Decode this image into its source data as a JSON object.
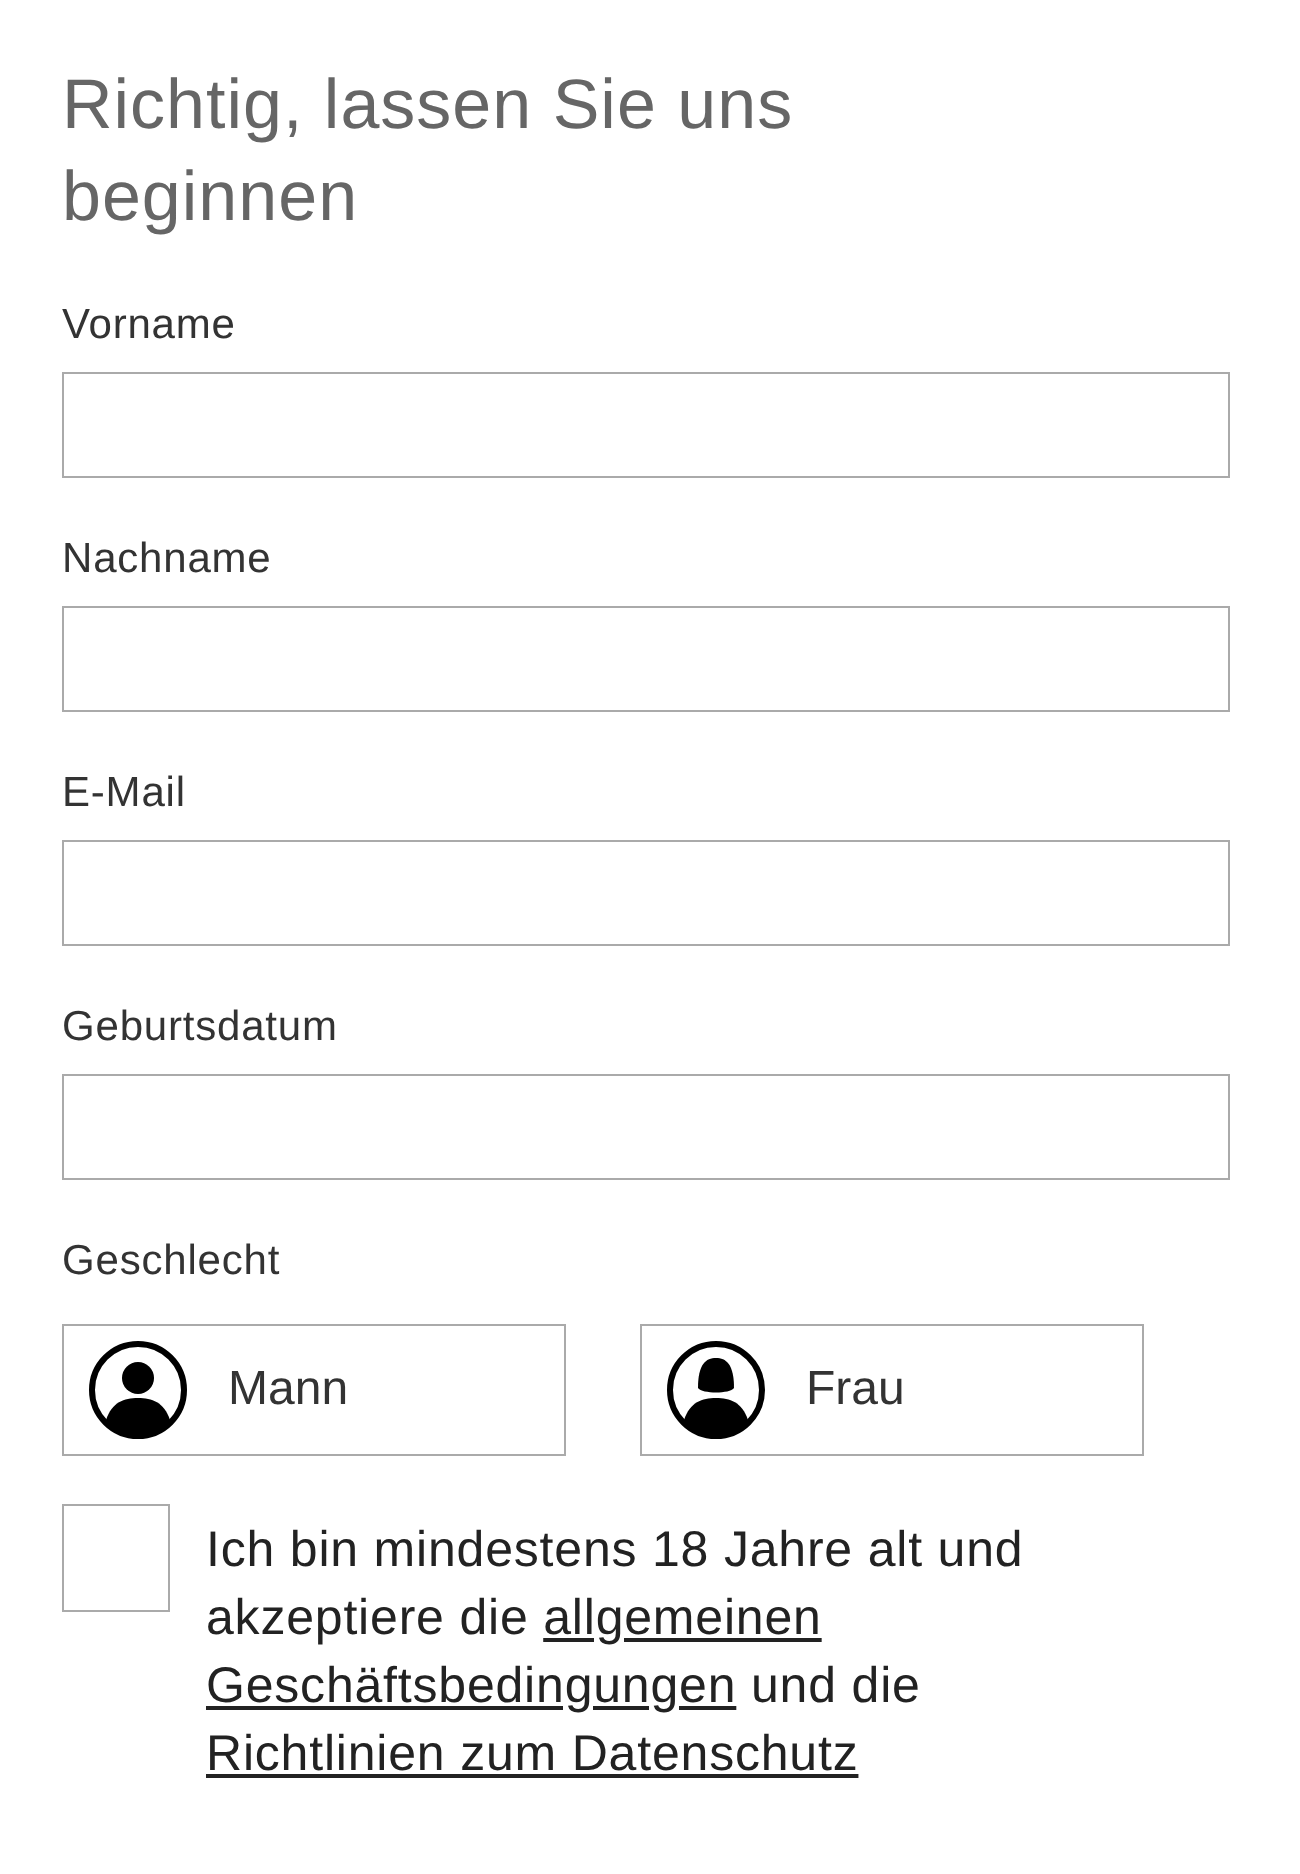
{
  "title": "Richtig, lassen Sie uns beginnen",
  "fields": [
    {
      "label": "Vorname"
    },
    {
      "label": "Nachname"
    },
    {
      "label": "E-Mail"
    },
    {
      "label": "Geburtsdatum"
    }
  ],
  "gender": {
    "label": "Geschlecht",
    "options": [
      {
        "label": "Mann",
        "kind": "male",
        "selected": false
      },
      {
        "label": "Frau",
        "kind": "female",
        "selected": false
      }
    ]
  },
  "consent": {
    "checked": false,
    "parts": [
      {
        "kind": "text",
        "text": "Ich bin mindestens 18 Jahre alt und akzeptiere die "
      },
      {
        "kind": "link",
        "text": "allgemeinen"
      },
      {
        "kind": "link",
        "text": "Geschäftsbedingungen"
      },
      {
        "kind": "text",
        "text": " und die "
      },
      {
        "kind": "link",
        "text": "Richtlinien zum Datenschutz"
      }
    ]
  }
}
